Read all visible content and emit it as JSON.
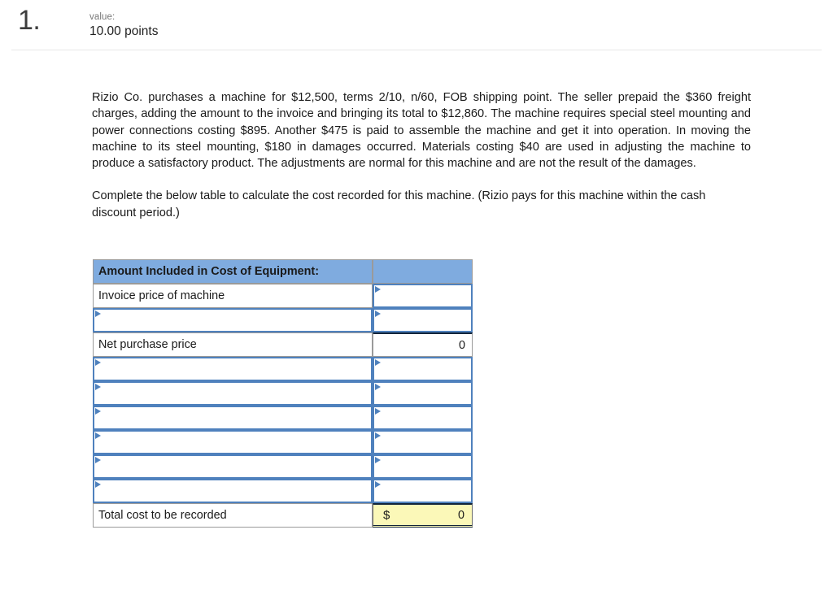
{
  "header": {
    "question_number": "1.",
    "value_label": "value:",
    "points": "10.00 points"
  },
  "problem": {
    "paragraph_1": "Rizio Co. purchases a machine for $12,500, terms 2/10, n/60, FOB shipping point. The seller prepaid the $360 freight charges, adding the amount to the invoice and bringing its total to $12,860. The machine requires special steel mounting and power connections costing $895. Another $475 is paid to assemble the machine and get it into operation. In moving the machine to its steel mounting, $180 in damages occurred. Materials costing $40 are used in adjusting the machine to produce a satisfactory product. The adjustments are normal for this machine and are not the result of the damages.",
    "paragraph_2": "Complete the below table to calculate the cost recorded for this machine. (Rizio pays for this machine within the cash discount period.)"
  },
  "table": {
    "header_label": "Amount Included in Cost of Equipment:",
    "header_value": "",
    "rows": [
      {
        "label": "Invoice price of machine",
        "label_editable": false,
        "value": "",
        "value_editable": true
      },
      {
        "label": "",
        "label_editable": true,
        "value": "",
        "value_editable": true
      },
      {
        "label": "Net purchase price",
        "label_editable": false,
        "value": "0",
        "value_editable": false
      },
      {
        "label": "",
        "label_editable": true,
        "value": "",
        "value_editable": true
      },
      {
        "label": "",
        "label_editable": true,
        "value": "",
        "value_editable": true
      },
      {
        "label": "",
        "label_editable": true,
        "value": "",
        "value_editable": true
      },
      {
        "label": "",
        "label_editable": true,
        "value": "",
        "value_editable": true
      },
      {
        "label": "",
        "label_editable": true,
        "value": "",
        "value_editable": true
      },
      {
        "label": "",
        "label_editable": true,
        "value": "",
        "value_editable": true
      }
    ],
    "total": {
      "label": "Total cost to be recorded",
      "currency": "$",
      "value": "0"
    }
  },
  "colors": {
    "header_blue": "#7fabdf",
    "edit_border_blue": "#4f81bd",
    "total_yellow": "#fbf8b8",
    "grid_gray": "#9a9a9a"
  }
}
